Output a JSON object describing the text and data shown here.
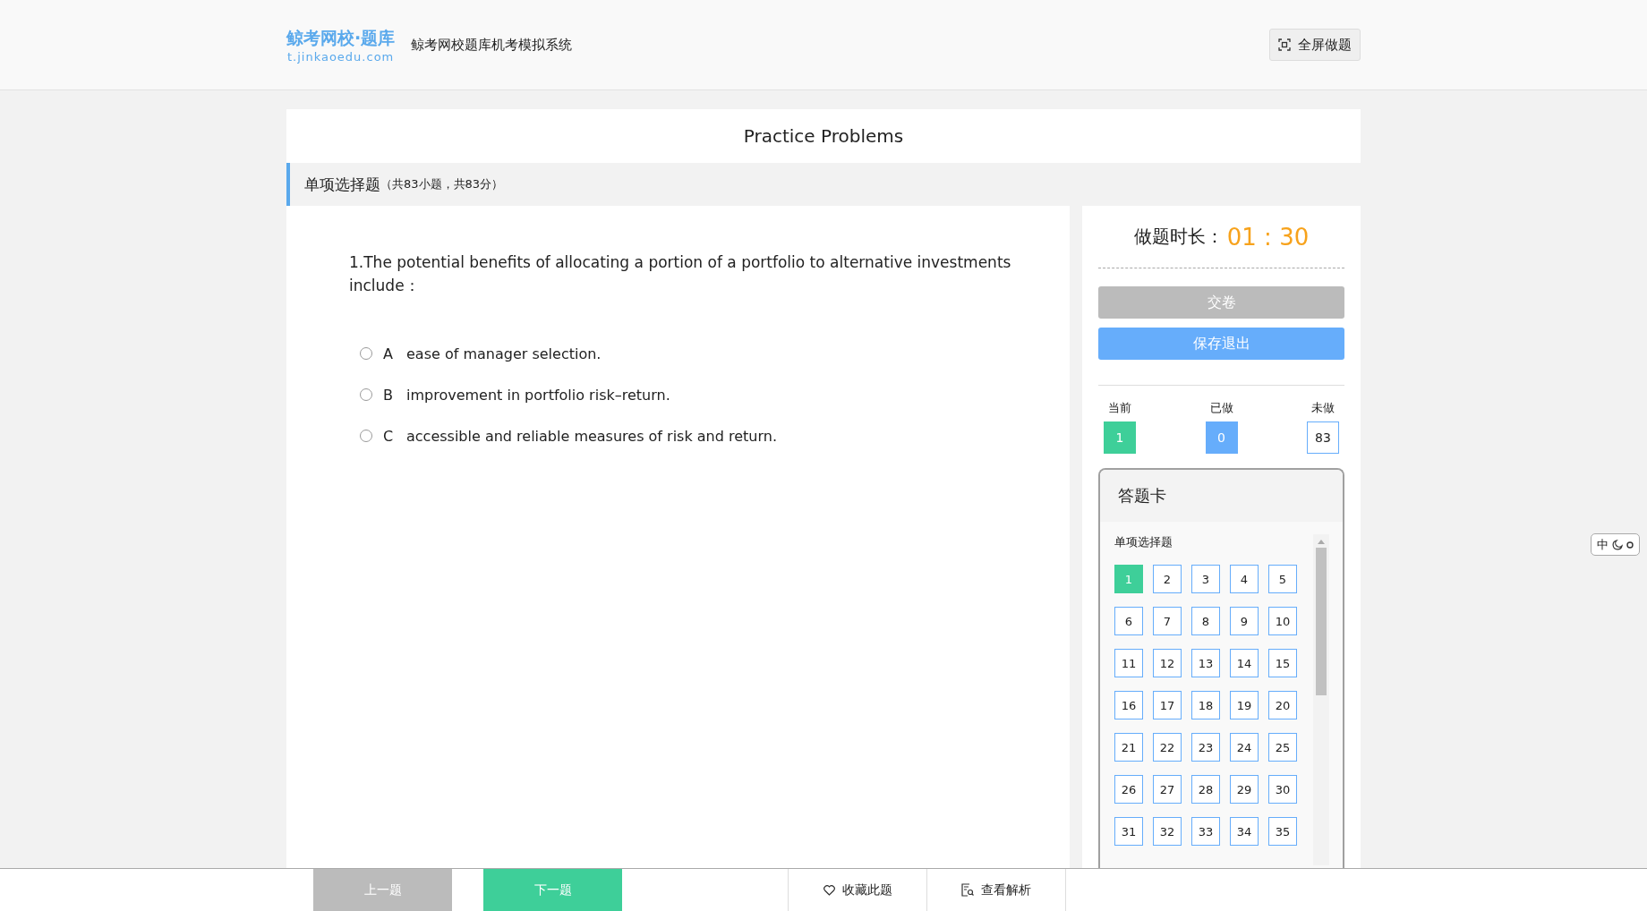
{
  "header": {
    "logo_title": "鲸考网校·题库",
    "logo_url": "t.jinkaoedu.com",
    "system_name": "鲸考网校题库机考模拟系统",
    "fullscreen_button": "全屏做题"
  },
  "paper_title": "Practice Problems",
  "section": {
    "name": "单项选择题",
    "info": "（共83小题，共83分）"
  },
  "question": {
    "text": "1.The potential benefits of allocating a portion of a portfolio to alternative investments include：",
    "options": [
      {
        "letter": "A",
        "text": "ease of manager selection.",
        "selected": false
      },
      {
        "letter": "B",
        "text": "improvement in portfolio risk–return.",
        "selected": false
      },
      {
        "letter": "C",
        "text": "accessible and reliable measures of risk and return.",
        "selected": false
      }
    ]
  },
  "timer": {
    "label": "做题时长：",
    "value": "01 : 30"
  },
  "submit_button": "交卷",
  "save_exit_button": "保存退出",
  "stats": [
    {
      "label": "当前",
      "value": "1",
      "kind": "current"
    },
    {
      "label": "已做",
      "value": "0",
      "kind": "done"
    },
    {
      "label": "未做",
      "value": "83",
      "kind": "todo"
    }
  ],
  "answer_card": {
    "title": "答题卡",
    "section": "单项选择题",
    "items": [
      {
        "number": "1",
        "kind": "current"
      },
      {
        "number": "2",
        "kind": "todo"
      },
      {
        "number": "3",
        "kind": "todo"
      },
      {
        "number": "4",
        "kind": "todo"
      },
      {
        "number": "5",
        "kind": "todo"
      },
      {
        "number": "6",
        "kind": "todo"
      },
      {
        "number": "7",
        "kind": "todo"
      },
      {
        "number": "8",
        "kind": "todo"
      },
      {
        "number": "9",
        "kind": "todo"
      },
      {
        "number": "10",
        "kind": "todo"
      },
      {
        "number": "11",
        "kind": "todo"
      },
      {
        "number": "12",
        "kind": "todo"
      },
      {
        "number": "13",
        "kind": "todo"
      },
      {
        "number": "14",
        "kind": "todo"
      },
      {
        "number": "15",
        "kind": "todo"
      },
      {
        "number": "16",
        "kind": "todo"
      },
      {
        "number": "17",
        "kind": "todo"
      },
      {
        "number": "18",
        "kind": "todo"
      },
      {
        "number": "19",
        "kind": "todo"
      },
      {
        "number": "20",
        "kind": "todo"
      },
      {
        "number": "21",
        "kind": "todo"
      },
      {
        "number": "22",
        "kind": "todo"
      },
      {
        "number": "23",
        "kind": "todo"
      },
      {
        "number": "24",
        "kind": "todo"
      },
      {
        "number": "25",
        "kind": "todo"
      },
      {
        "number": "26",
        "kind": "todo"
      },
      {
        "number": "27",
        "kind": "todo"
      },
      {
        "number": "28",
        "kind": "todo"
      },
      {
        "number": "29",
        "kind": "todo"
      },
      {
        "number": "30",
        "kind": "todo"
      },
      {
        "number": "31",
        "kind": "todo"
      },
      {
        "number": "32",
        "kind": "todo"
      },
      {
        "number": "33",
        "kind": "todo"
      },
      {
        "number": "34",
        "kind": "todo"
      },
      {
        "number": "35",
        "kind": "todo"
      }
    ]
  },
  "bottom_bar": {
    "prev": "上一题",
    "next": "下一题",
    "favorite": "收藏此题",
    "analysis": "查看解析"
  },
  "ime": {
    "mode": "中"
  }
}
